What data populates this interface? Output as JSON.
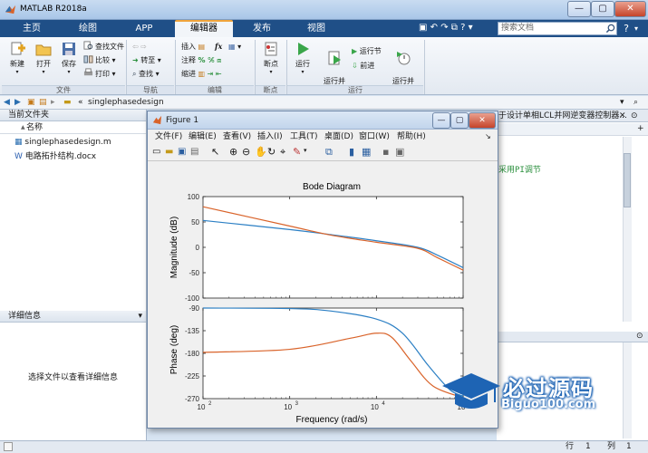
{
  "window": {
    "title": "MATLAB R2018a"
  },
  "ribbon_tabs": [
    {
      "label": "主页"
    },
    {
      "label": "绘图"
    },
    {
      "label": "APP"
    },
    {
      "label": "编辑器",
      "active": true
    },
    {
      "label": "发布"
    },
    {
      "label": "视图"
    }
  ],
  "search": {
    "placeholder": "搜索文档"
  },
  "ribbon": {
    "file": {
      "group": "文件",
      "new": "新建",
      "open": "打开",
      "save": "保存",
      "find_files": "查找文件",
      "compare": "比较",
      "print": "打印"
    },
    "navigate": {
      "group": "导航",
      "goto": "转至",
      "find": "查找"
    },
    "edit": {
      "group": "编辑",
      "insert": "插入",
      "comment": "注释",
      "indent": "缩进",
      "fx": "fx"
    },
    "breakpoints": {
      "group": "断点",
      "label": "断点"
    },
    "run": {
      "group": "运行",
      "run": "运行",
      "run_advance": "运行并\n前进",
      "run_section": "运行节",
      "advance": "前进",
      "run_time": "运行并\n计时"
    }
  },
  "pathbar": {
    "separator": "«",
    "path": "singlephasedesign"
  },
  "folder_panel": {
    "title": "当前文件夹",
    "column_name": "名称",
    "sort_arrow": "▲",
    "files": [
      {
        "name": "singlephasedesign.m"
      },
      {
        "name": "电路拓扑结构.docx"
      }
    ]
  },
  "details_panel": {
    "title": "详细信息",
    "empty_text": "选择文件以查看详细信息"
  },
  "editor": {
    "tab_text": "于设计单相LCL并网逆变器控制器...",
    "visible_code": "采用PI调节"
  },
  "statusbar": {
    "row": "行",
    "row_value": "1",
    "col": "列",
    "col_value": "1"
  },
  "figure": {
    "title": "Figure 1",
    "menu": [
      "文件(F)",
      "编辑(E)",
      "查看(V)",
      "插入(I)",
      "工具(T)",
      "桌面(D)",
      "窗口(W)",
      "帮助(H)"
    ]
  },
  "chart_data": {
    "type": "line",
    "title": "Bode Diagram",
    "xlabel": "Frequency  (rad/s)",
    "x_scale": "log",
    "xlim": [
      100,
      100000
    ],
    "x_ticks": [
      {
        "base": "10",
        "exp": "2"
      },
      {
        "base": "10",
        "exp": "3"
      },
      {
        "base": "10",
        "exp": "4"
      },
      {
        "base": "10",
        "exp": "5"
      }
    ],
    "x_tick_values": [
      100,
      1000,
      10000,
      100000
    ],
    "grid": false,
    "colors": {
      "blue": "#2b7fc4",
      "orange": "#d9632a"
    },
    "magnitude": {
      "ylabel": "Magnitude (dB)",
      "ylim": [
        -100,
        100
      ],
      "ticks": [
        100,
        50,
        0,
        -50,
        -100
      ],
      "series": [
        {
          "color": "blue",
          "x": [
            100,
            1000,
            3000,
            10000,
            30000,
            50000,
            100000
          ],
          "y": [
            53,
            35,
            25,
            13,
            0,
            -15,
            -40
          ]
        },
        {
          "color": "orange",
          "x": [
            100,
            1000,
            3000,
            10000,
            30000,
            50000,
            100000
          ],
          "y": [
            80,
            42,
            24,
            10,
            -2,
            -20,
            -45
          ]
        }
      ]
    },
    "phase": {
      "ylabel": "Phase (deg)",
      "ylim": [
        -270,
        -90
      ],
      "ticks": [
        -90,
        -135,
        -180,
        -225,
        -270
      ],
      "series": [
        {
          "color": "blue",
          "x": [
            100,
            1000,
            3000,
            10000,
            20000,
            40000,
            70000,
            100000
          ],
          "y": [
            -90,
            -91,
            -96,
            -112,
            -140,
            -205,
            -252,
            -265
          ]
        },
        {
          "color": "orange",
          "x": [
            100,
            1000,
            5000,
            10000,
            15000,
            25000,
            45000,
            100000
          ],
          "y": [
            -178,
            -172,
            -150,
            -140,
            -148,
            -195,
            -245,
            -268
          ]
        }
      ]
    }
  },
  "watermark": {
    "main": "必过源码",
    "sub": "Biguo100.com"
  }
}
